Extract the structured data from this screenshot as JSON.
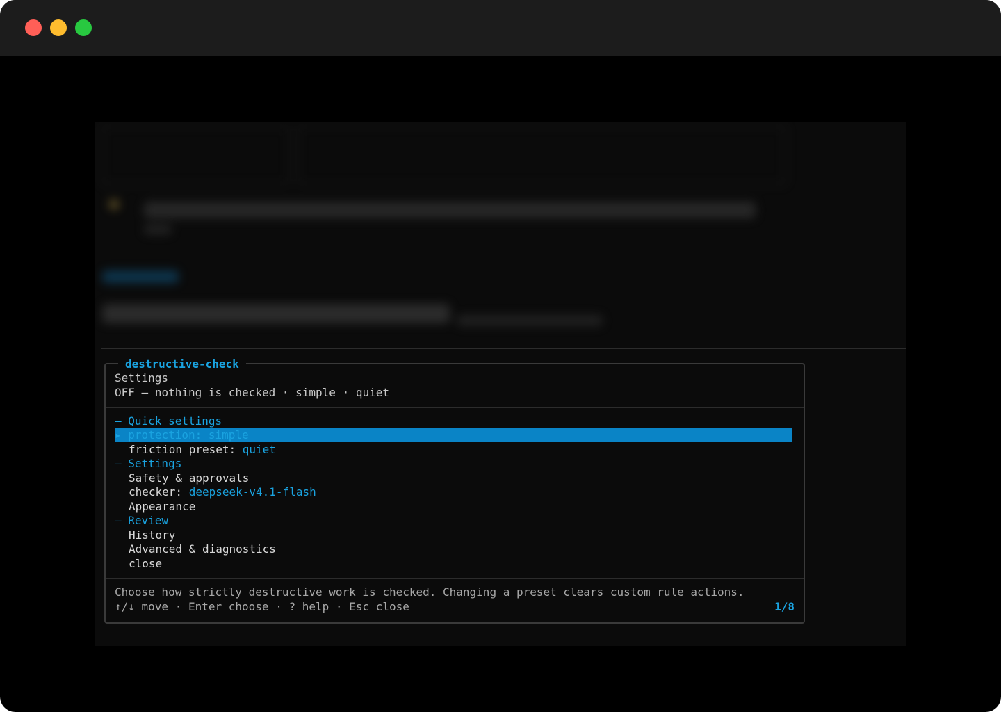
{
  "window": {
    "traffic_lights": [
      "close",
      "minimize",
      "zoom"
    ]
  },
  "panel": {
    "title": "destructive-check",
    "subtitle": "Settings",
    "status": {
      "prefix": "OFF",
      "dash": "—",
      "text": "nothing is checked",
      "dot1": "·",
      "mode": "simple",
      "dot2": "·",
      "preset": "quiet"
    },
    "menu": {
      "quick_settings_header": "— Quick settings",
      "protection": {
        "marker": "▸",
        "label": "protection:",
        "value": "simple"
      },
      "friction": {
        "label": "friction preset:",
        "value": "quiet"
      },
      "settings_header": "— Settings",
      "safety": "Safety & approvals",
      "checker": {
        "label": "checker:",
        "value": "deepseek-v4.1-flash"
      },
      "appearance": "Appearance",
      "review_header": "— Review",
      "history": "History",
      "advanced": "Advanced & diagnostics",
      "close": "close"
    },
    "footer": {
      "description": "Choose how strictly destructive work is checked. Changing a preset clears custom rule actions.",
      "hints": "↑/↓ move · Enter choose · ? help · Esc close",
      "counter": "1/8"
    }
  },
  "colors": {
    "accent": "#1aa3e0",
    "selection": "#0a84c6",
    "background": "#0b0b0b",
    "titlebar": "#1c1c1c"
  }
}
